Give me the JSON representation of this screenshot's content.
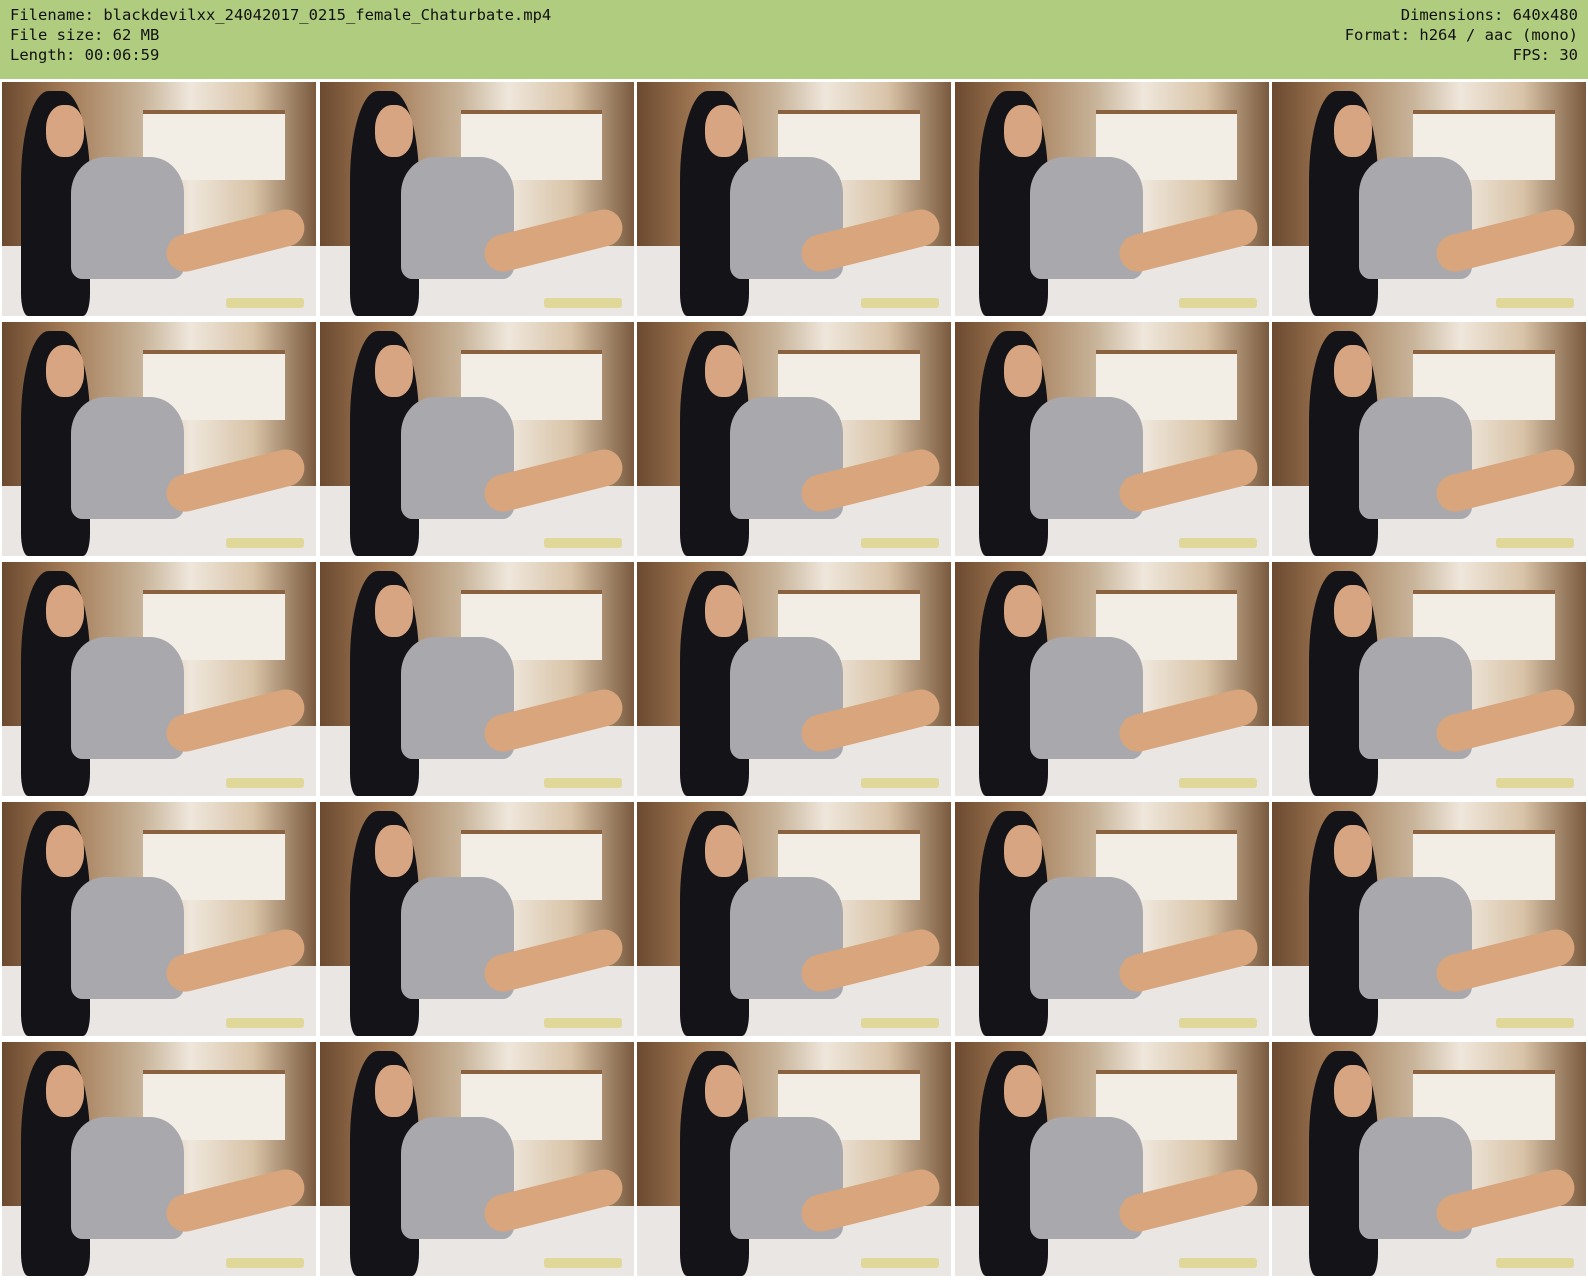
{
  "header": {
    "filename": "Filename: blackdevilxx_24042017_0215_female_Chaturbate.mp4",
    "file_size": "File size: 62 MB",
    "length": "Length: 00:06:59",
    "dimensions": "Dimensions: 640x480",
    "format": "Format: h264 / aac (mono)",
    "fps": "FPS: 30"
  },
  "grid": {
    "columns": 5,
    "rows": 5,
    "frame_count": 25
  },
  "colors": {
    "header_bg": "#b0cc7e"
  }
}
